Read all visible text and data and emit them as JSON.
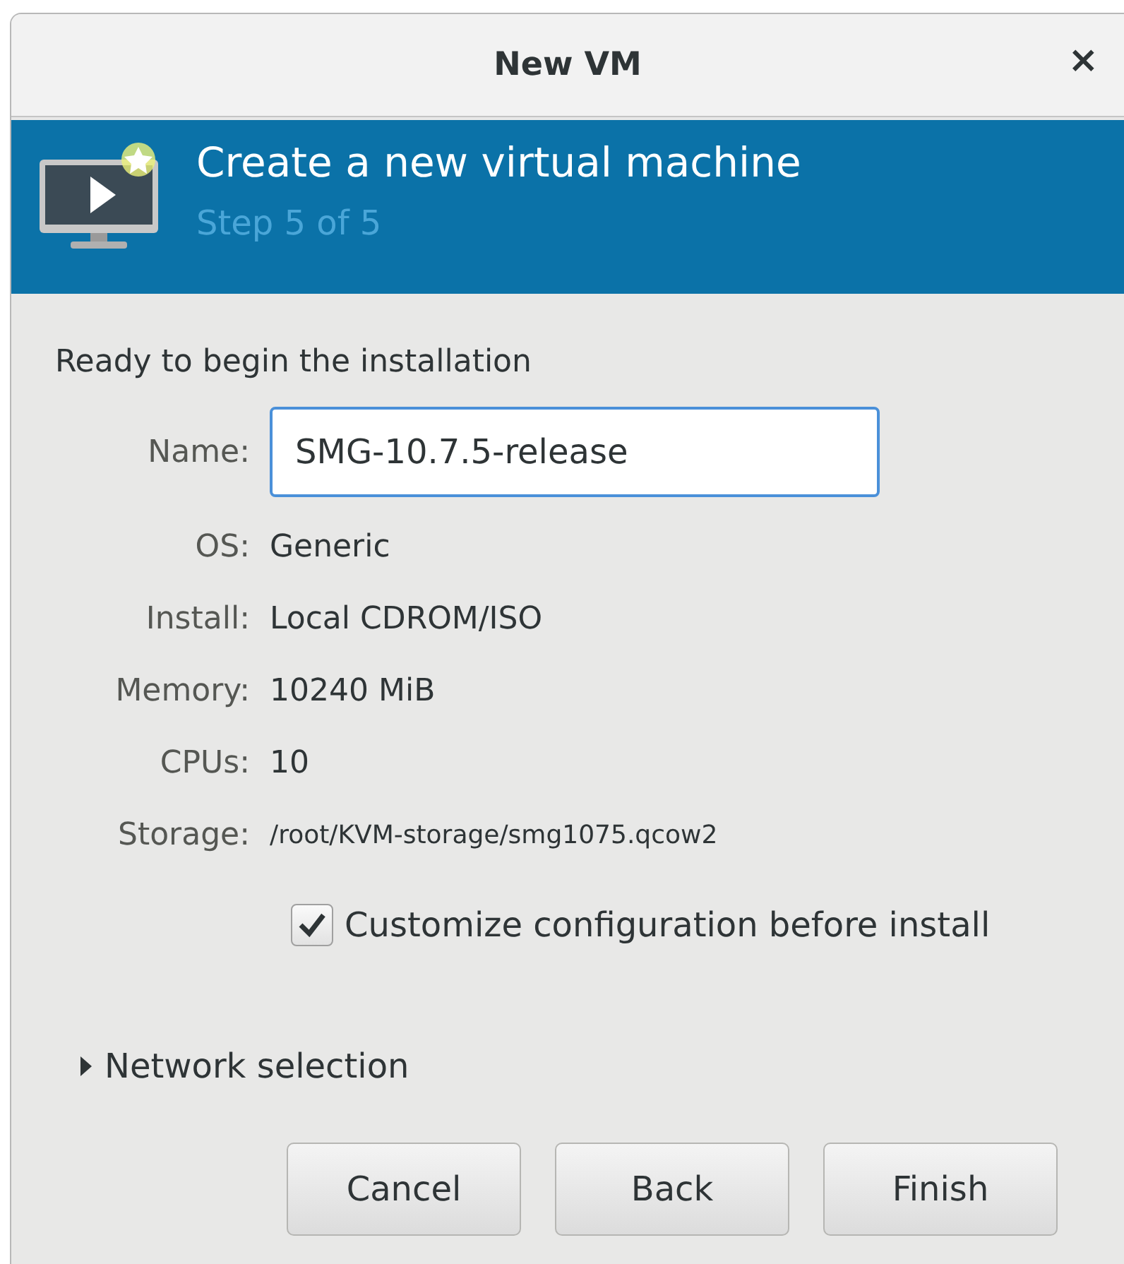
{
  "window": {
    "title": "New VM",
    "close": "×"
  },
  "banner": {
    "title": "Create a new virtual machine",
    "subtitle": "Step 5 of 5"
  },
  "heading": "Ready to begin the installation",
  "name_field": {
    "label": "Name:",
    "value": "SMG-10.7.5-release",
    "focused": true
  },
  "details": [
    {
      "label": "OS:",
      "value": "Generic",
      "kind": "normal"
    },
    {
      "label": "Install:",
      "value": "Local CDROM/ISO",
      "kind": "normal"
    },
    {
      "label": "Memory:",
      "value": "10240 MiB",
      "kind": "normal"
    },
    {
      "label": "CPUs:",
      "value": "10",
      "kind": "normal"
    },
    {
      "label": "Storage:",
      "value": "/root/KVM-storage/smg1075.qcow2",
      "kind": "small"
    }
  ],
  "customize": {
    "label": "Customize configuration before install",
    "checked": true
  },
  "network": {
    "label": "Network selection",
    "expanded": false
  },
  "buttons": [
    "Cancel",
    "Back",
    "Finish"
  ]
}
